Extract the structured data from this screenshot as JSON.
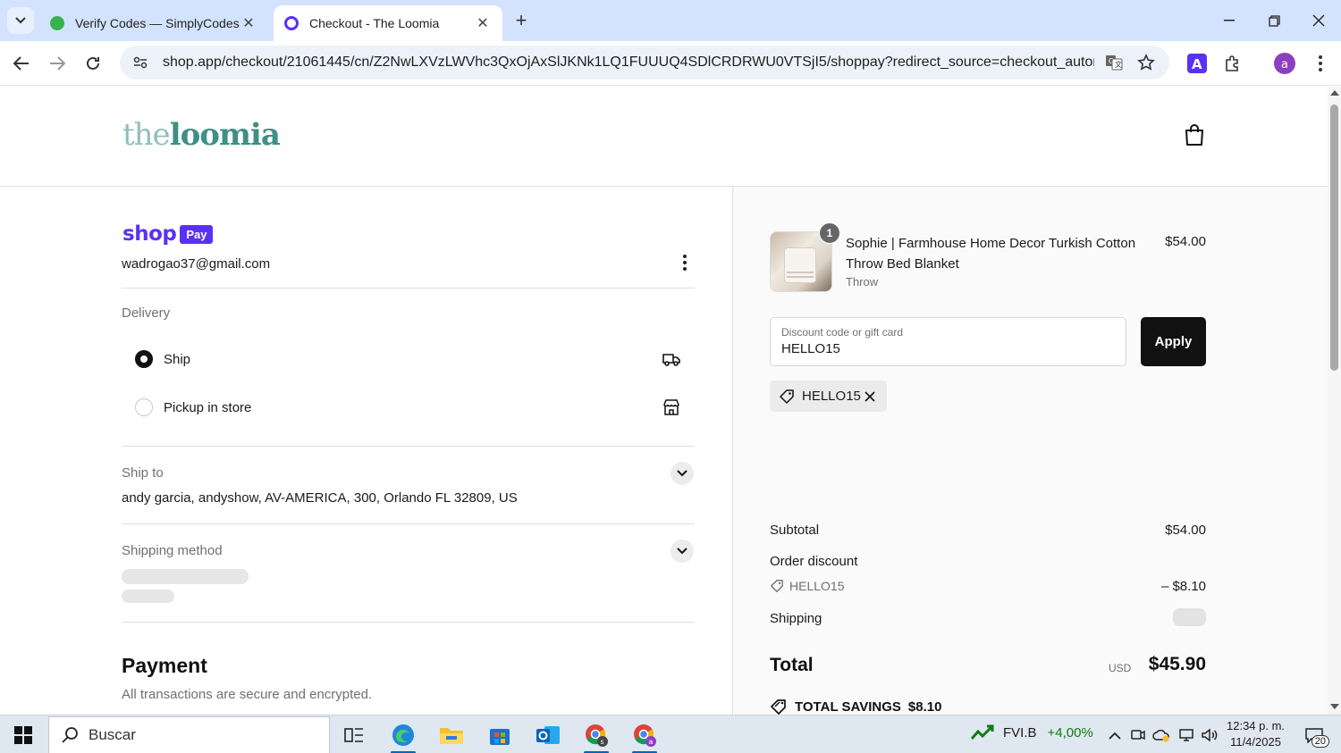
{
  "browser": {
    "tabs": [
      {
        "title": "Verify Codes — SimplyCodes",
        "active": false
      },
      {
        "title": "Checkout - The Loomia",
        "active": true
      }
    ],
    "url": "shop.app/checkout/21061445/cn/Z2NwLXVzLWVhc3QxOjAxSlJKNk1LQ1FUUUQ4SDlCRDRWU0VTSjI5/shoppay?redirect_source=checkout_automatic_redi..."
  },
  "header": {
    "logo_the": "the",
    "logo_loomia": "loomia"
  },
  "shoppay": {
    "shop_word": "shop",
    "pay_badge": "Pay",
    "email": "wadrogao37@gmail.com"
  },
  "delivery": {
    "label": "Delivery",
    "options": [
      {
        "label": "Ship",
        "selected": true,
        "icon": "truck-icon"
      },
      {
        "label": "Pickup in store",
        "selected": false,
        "icon": "store-icon"
      }
    ]
  },
  "ship_to": {
    "label": "Ship to",
    "address": "andy garcia, andyshow, AV-AMERICA, 300, Orlando FL 32809, US"
  },
  "shipping_method": {
    "label": "Shipping method"
  },
  "payment": {
    "title": "Payment",
    "subtitle": "All transactions are secure and encrypted."
  },
  "order": {
    "item": {
      "quantity": "1",
      "name": "Sophie | Farmhouse Home Decor Turkish Cotton Throw Bed Blanket",
      "variant": "Throw",
      "price": "$54.00"
    },
    "discount_field": {
      "placeholder": "Discount code or gift card",
      "value": "HELLO15"
    },
    "apply_label": "Apply",
    "applied_code": "HELLO15",
    "subtotal_label": "Subtotal",
    "subtotal_value": "$54.00",
    "order_discount_label": "Order discount",
    "discount_code": "HELLO15",
    "discount_value": "– $8.10",
    "shipping_label": "Shipping",
    "total_label": "Total",
    "total_currency": "USD",
    "total_value": "$45.90",
    "savings_label": "TOTAL SAVINGS",
    "savings_value": "$8.10"
  },
  "taskbar": {
    "search_text": "Buscar",
    "stock_name": "FVI.B",
    "stock_change": "+4,00%",
    "time": "12:34 p. m.",
    "date": "11/4/2025",
    "notification_count": "20"
  },
  "colors": {
    "shop_purple": "#5a31f4",
    "logo_teal": "#3f8f86",
    "tabbar_blue": "#d3e3fd"
  }
}
